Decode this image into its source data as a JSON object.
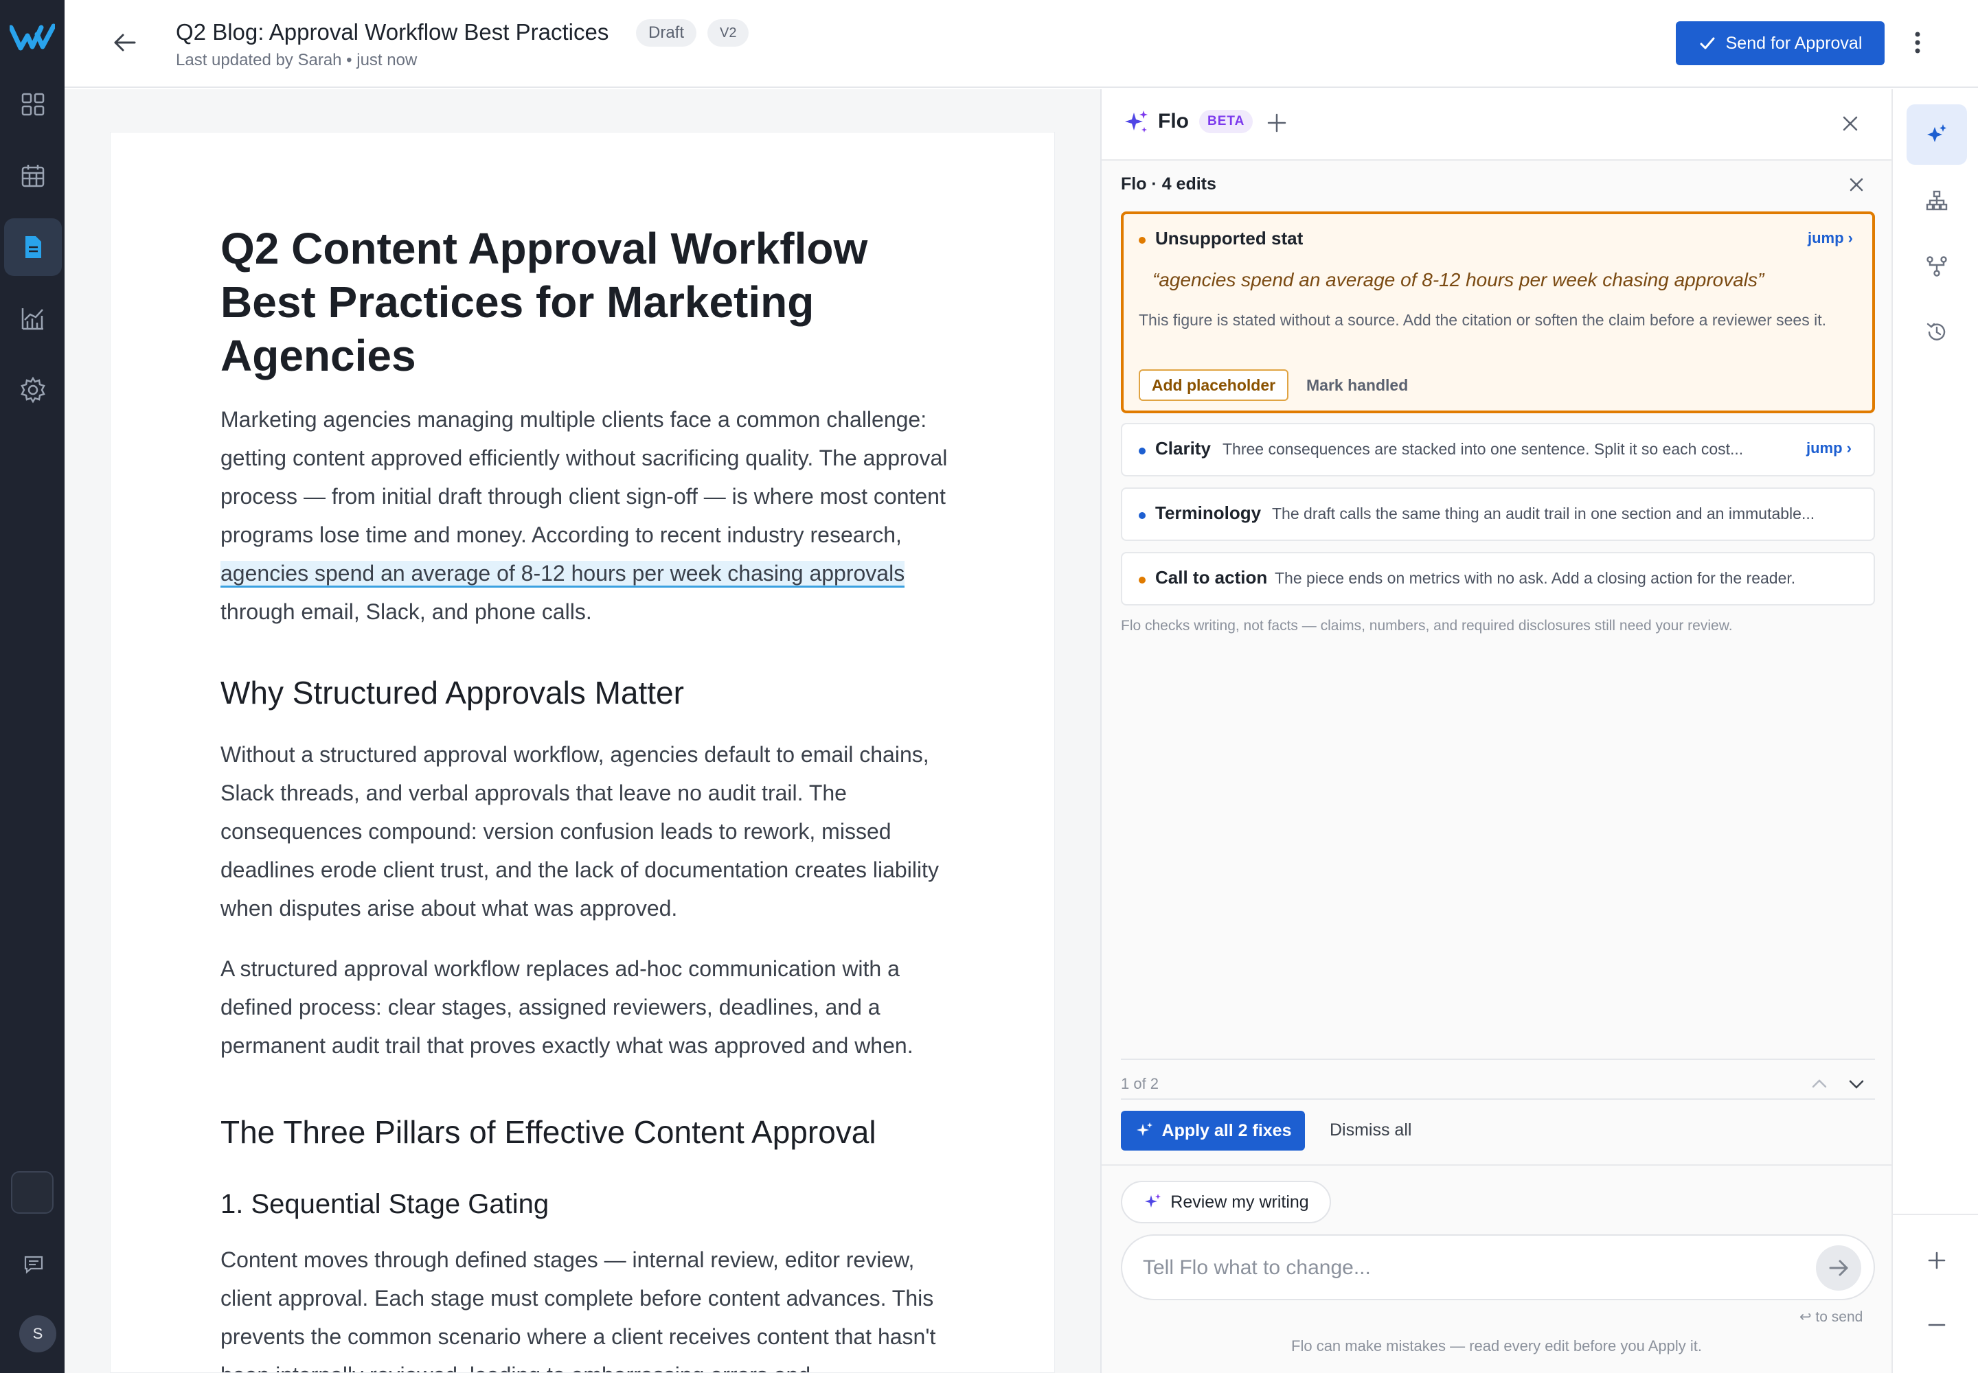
{
  "header": {
    "title": "Q2 Blog: Approval Workflow Best Practices",
    "status_badge": "Draft",
    "version_badge": "V2",
    "subtitle": "Last updated by Sarah • just now",
    "send_label": "Send for Approval"
  },
  "nav": {
    "items": [
      "dashboard-icon",
      "calendar-icon",
      "document-icon",
      "analytics-icon",
      "settings-icon"
    ],
    "active": "document-icon",
    "avatar_initial": "S"
  },
  "document": {
    "title": "Q2 Content Approval Workflow Best Practices for Marketing Agencies",
    "intro_before": "Marketing agencies managing multiple clients face a common challenge: getting content approved efficiently without sacrificing quality. The approval process — from initial draft through client sign-off — is where most content programs lose time and money. According to recent industry research, ",
    "intro_highlight": "agencies spend an average of 8-12 hours per week chasing approvals",
    "intro_after": " through email, Slack, and phone calls.",
    "h2_1": "Why Structured Approvals Matter",
    "para_2": "Without a structured approval workflow, agencies default to email chains, Slack threads, and verbal approvals that leave no audit trail. The consequences compound: version confusion leads to rework, missed deadlines erode client trust, and the lack of documentation creates liability when disputes arise about what was approved.",
    "para_3": "A structured approval workflow replaces ad-hoc communication with a defined process: clear stages, assigned reviewers, deadlines, and a permanent audit trail that proves exactly what was approved and when.",
    "h2_2": "The Three Pillars of Effective Content Approval",
    "h3_1": "1. Sequential Stage Gating",
    "para_4": "Content moves through defined stages — internal review, editor review, client approval. Each stage must complete before content advances. This prevents the common scenario where a client receives content that hasn't been internally reviewed, leading to embarrassing errors and"
  },
  "flo": {
    "name": "Flo",
    "beta": "BETA",
    "edits_title": "Flo · 4 edits",
    "cards": [
      {
        "label": "Unsupported stat",
        "quote": "“agencies spend an average of 8-12 hours per week chasing approvals”",
        "note": "This figure is stated without a source. Add the citation or soften the claim before a reviewer sees it.",
        "jump": "jump ›",
        "primary_action": "Add placeholder",
        "secondary_action": "Mark handled",
        "dot_color": "#e07b00"
      },
      {
        "label": "Clarity",
        "desc": "Three consequences are stacked into one sentence. Split it so each cost...",
        "jump": "jump ›",
        "dot_color": "#1d5fd1"
      },
      {
        "label": "Terminology",
        "desc": "The draft calls the same thing an audit trail in one section and an immutable...",
        "dot_color": "#1d5fd1"
      },
      {
        "label": "Call to action",
        "desc": "The piece ends on metrics with no ask. Add a closing action for the reader.",
        "dot_color": "#e07b00"
      }
    ],
    "disclaimer": "Flo checks writing, not facts — claims, numbers, and required disclosures still need your review.",
    "pager": "1 of 2",
    "apply_label": "Apply all 2 fixes",
    "dismiss_label": "Dismiss all",
    "review_chip": "Review my writing",
    "composer_placeholder": "Tell Flo what to change...",
    "enter_hint": "↩ to send",
    "footer_note": "Flo can make mistakes — read every edit before you Apply it."
  },
  "tools": {
    "items": [
      "flo-sparkle-icon",
      "sitemap-icon",
      "branch-icon",
      "history-icon"
    ],
    "active": "flo-sparkle-icon",
    "zoom_in": "plus-icon",
    "zoom_out": "minus-icon"
  },
  "colors": {
    "accent": "#1d5fd1",
    "warning": "#e07b00",
    "rail": "#1f2430",
    "highlight": "#e3f2fc"
  }
}
